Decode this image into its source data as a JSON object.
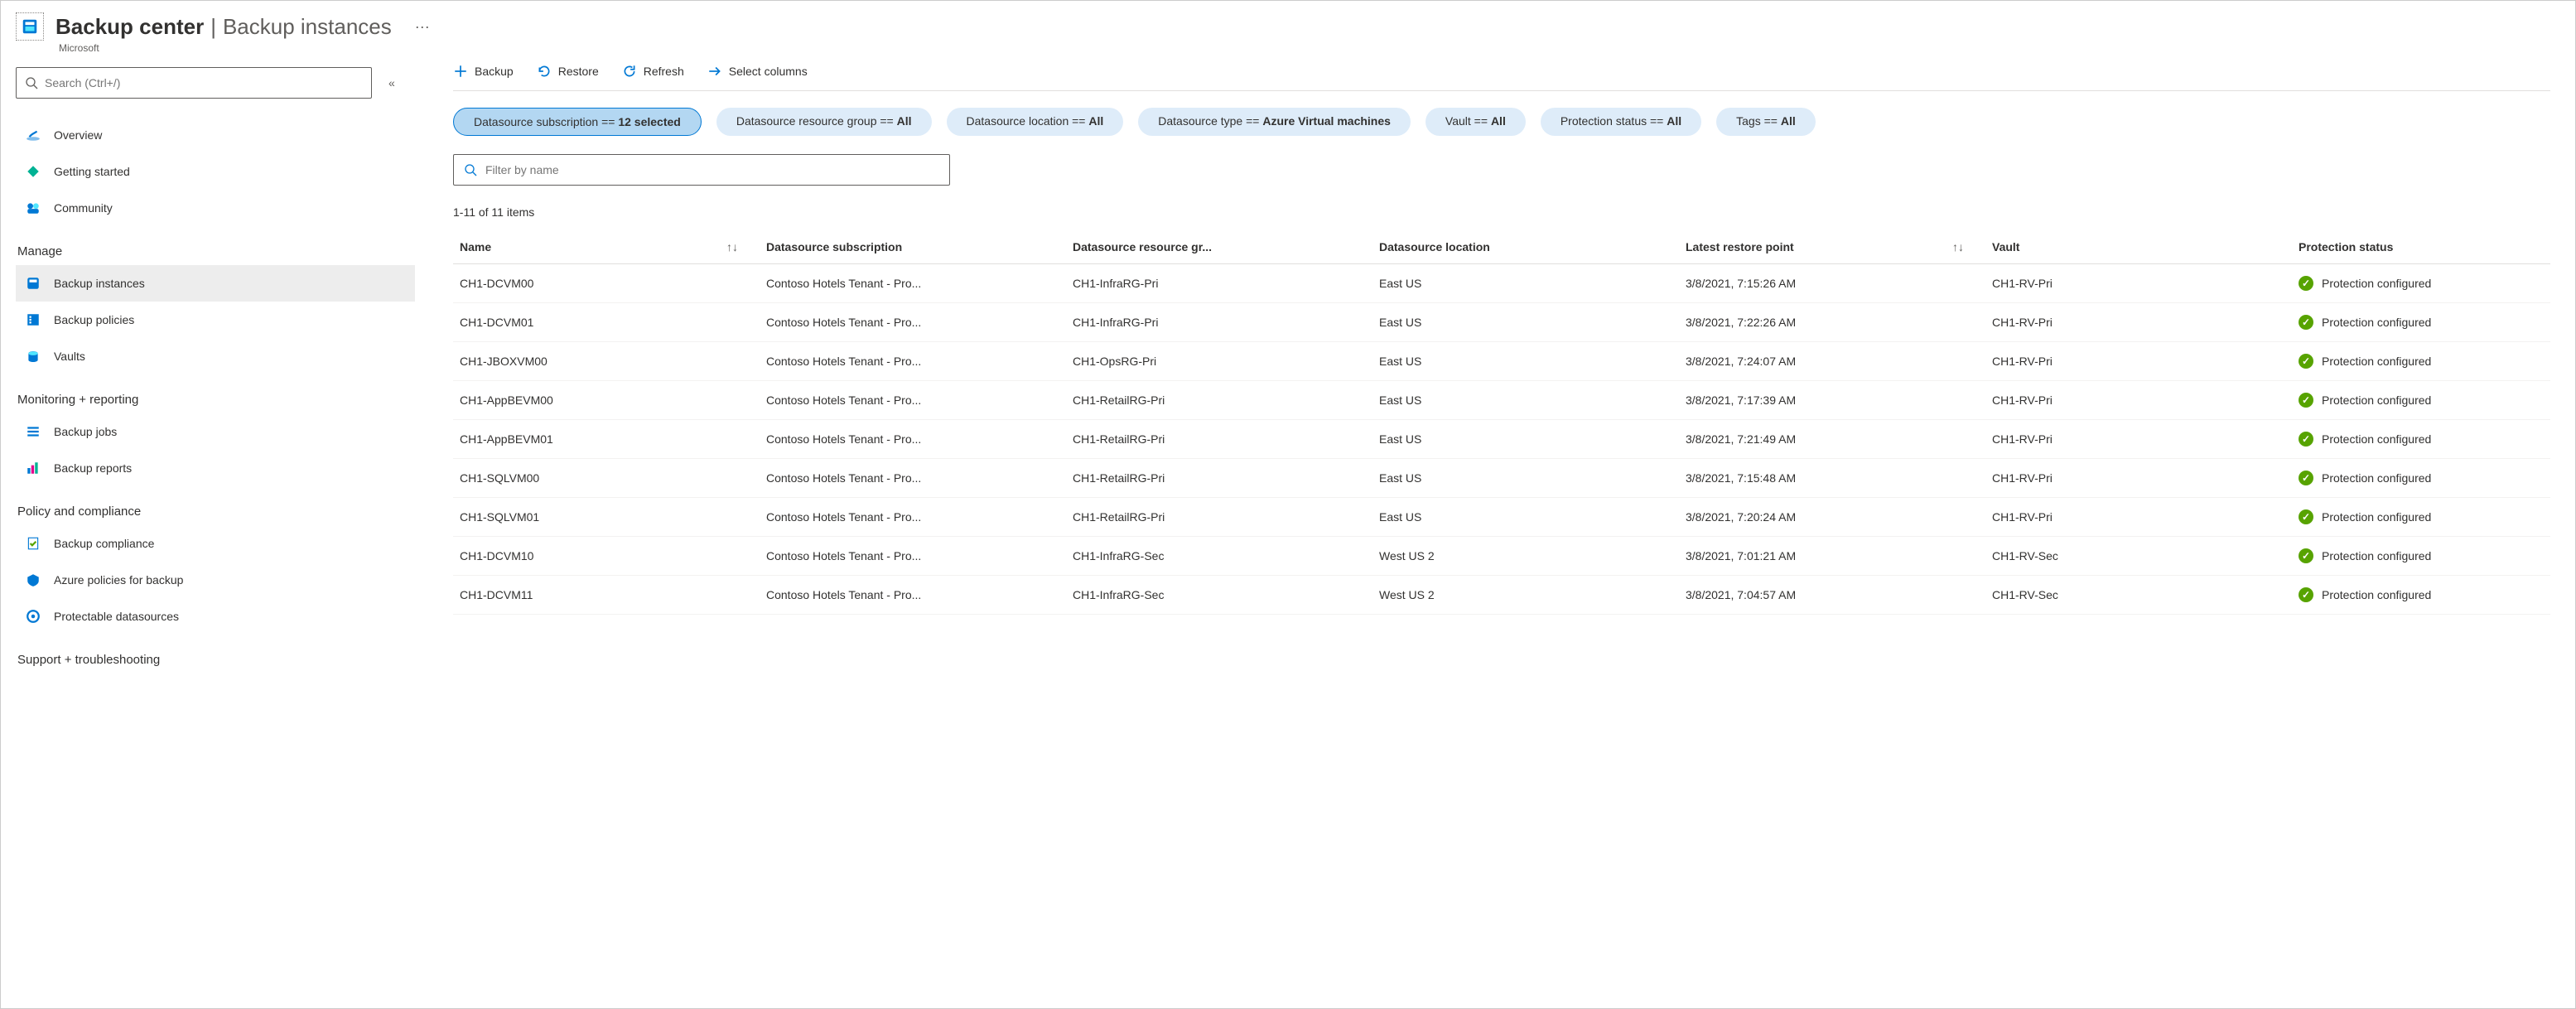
{
  "header": {
    "title": "Backup center",
    "subtitle": "Backup instances",
    "company": "Microsoft"
  },
  "search": {
    "placeholder": "Search (Ctrl+/)"
  },
  "sidebar": {
    "items_top": [
      {
        "label": "Overview"
      },
      {
        "label": "Getting started"
      },
      {
        "label": "Community"
      }
    ],
    "section_manage": "Manage",
    "items_manage": [
      {
        "label": "Backup instances",
        "active": true
      },
      {
        "label": "Backup policies"
      },
      {
        "label": "Vaults"
      }
    ],
    "section_monitor": "Monitoring + reporting",
    "items_monitor": [
      {
        "label": "Backup jobs"
      },
      {
        "label": "Backup reports"
      }
    ],
    "section_policy": "Policy and compliance",
    "items_policy": [
      {
        "label": "Backup compliance"
      },
      {
        "label": "Azure policies for backup"
      },
      {
        "label": "Protectable datasources"
      }
    ],
    "section_support": "Support + troubleshooting"
  },
  "toolbar": {
    "backup": "Backup",
    "restore": "Restore",
    "refresh": "Refresh",
    "select_columns": "Select columns"
  },
  "filters": {
    "subscription_label": "Datasource subscription == ",
    "subscription_value": "12 selected",
    "rg_label": "Datasource resource group == ",
    "rg_value": "All",
    "location_label": "Datasource location == ",
    "location_value": "All",
    "type_label": "Datasource type == ",
    "type_value": "Azure Virtual machines",
    "vault_label": "Vault == ",
    "vault_value": "All",
    "protection_label": "Protection status == ",
    "protection_value": "All",
    "tags_label": "Tags == ",
    "tags_value": "All"
  },
  "filter_input_placeholder": "Filter by name",
  "count_text": "1-11 of 11 items",
  "columns": {
    "name": "Name",
    "subscription": "Datasource subscription",
    "rg": "Datasource resource gr...",
    "location": "Datasource location",
    "restore": "Latest restore point",
    "vault": "Vault",
    "status": "Protection status"
  },
  "rows": [
    {
      "name": "CH1-DCVM00",
      "subscription": "Contoso Hotels Tenant - Pro...",
      "rg": "CH1-InfraRG-Pri",
      "location": "East US",
      "restore": "3/8/2021, 7:15:26 AM",
      "vault": "CH1-RV-Pri",
      "status": "Protection configured"
    },
    {
      "name": "CH1-DCVM01",
      "subscription": "Contoso Hotels Tenant - Pro...",
      "rg": "CH1-InfraRG-Pri",
      "location": "East US",
      "restore": "3/8/2021, 7:22:26 AM",
      "vault": "CH1-RV-Pri",
      "status": "Protection configured"
    },
    {
      "name": "CH1-JBOXVM00",
      "subscription": "Contoso Hotels Tenant - Pro...",
      "rg": "CH1-OpsRG-Pri",
      "location": "East US",
      "restore": "3/8/2021, 7:24:07 AM",
      "vault": "CH1-RV-Pri",
      "status": "Protection configured"
    },
    {
      "name": "CH1-AppBEVM00",
      "subscription": "Contoso Hotels Tenant - Pro...",
      "rg": "CH1-RetailRG-Pri",
      "location": "East US",
      "restore": "3/8/2021, 7:17:39 AM",
      "vault": "CH1-RV-Pri",
      "status": "Protection configured"
    },
    {
      "name": "CH1-AppBEVM01",
      "subscription": "Contoso Hotels Tenant - Pro...",
      "rg": "CH1-RetailRG-Pri",
      "location": "East US",
      "restore": "3/8/2021, 7:21:49 AM",
      "vault": "CH1-RV-Pri",
      "status": "Protection configured"
    },
    {
      "name": "CH1-SQLVM00",
      "subscription": "Contoso Hotels Tenant - Pro...",
      "rg": "CH1-RetailRG-Pri",
      "location": "East US",
      "restore": "3/8/2021, 7:15:48 AM",
      "vault": "CH1-RV-Pri",
      "status": "Protection configured"
    },
    {
      "name": "CH1-SQLVM01",
      "subscription": "Contoso Hotels Tenant - Pro...",
      "rg": "CH1-RetailRG-Pri",
      "location": "East US",
      "restore": "3/8/2021, 7:20:24 AM",
      "vault": "CH1-RV-Pri",
      "status": "Protection configured"
    },
    {
      "name": "CH1-DCVM10",
      "subscription": "Contoso Hotels Tenant - Pro...",
      "rg": "CH1-InfraRG-Sec",
      "location": "West US 2",
      "restore": "3/8/2021, 7:01:21 AM",
      "vault": "CH1-RV-Sec",
      "status": "Protection configured"
    },
    {
      "name": "CH1-DCVM11",
      "subscription": "Contoso Hotels Tenant - Pro...",
      "rg": "CH1-InfraRG-Sec",
      "location": "West US 2",
      "restore": "3/8/2021, 7:04:57 AM",
      "vault": "CH1-RV-Sec",
      "status": "Protection configured"
    }
  ]
}
